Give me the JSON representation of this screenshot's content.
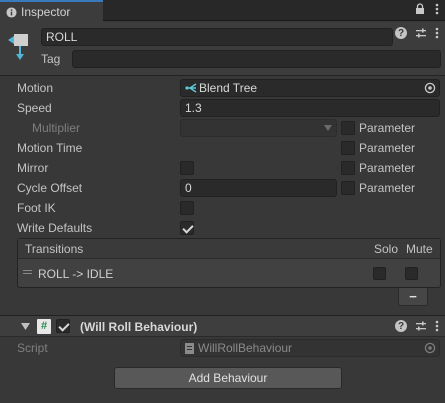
{
  "window": {
    "tab_label": "Inspector"
  },
  "state": {
    "name": "ROLL",
    "tag_label": "Tag",
    "tag_value": ""
  },
  "properties": {
    "motion_label": "Motion",
    "motion_value": "Blend Tree",
    "speed_label": "Speed",
    "speed_value": "1.3",
    "multiplier_label": "Multiplier",
    "motion_time_label": "Motion Time",
    "mirror_label": "Mirror",
    "cycle_offset_label": "Cycle Offset",
    "cycle_offset_value": "0",
    "foot_ik_label": "Foot IK",
    "write_defaults_label": "Write Defaults",
    "parameter_label": "Parameter"
  },
  "checks": {
    "multiplier_param": false,
    "motion_time_param": false,
    "mirror": false,
    "mirror_param": false,
    "cycle_offset_param": false,
    "foot_ik": false,
    "write_defaults": true
  },
  "transitions": {
    "header": "Transitions",
    "solo_label": "Solo",
    "mute_label": "Mute",
    "items": [
      {
        "label": "ROLL -> IDLE",
        "solo": false,
        "mute": false
      }
    ],
    "remove_label": "−"
  },
  "behaviour": {
    "title": "(Will Roll Behaviour)",
    "enabled": true,
    "script_label": "Script",
    "script_value": "WillRollBehaviour",
    "add_label": "Add Behaviour"
  },
  "colors": {
    "accent": "#3a79bb",
    "background": "#383838",
    "field": "#2a2a2a",
    "blend_tree_icon": "#5fc8d8"
  },
  "icons": {
    "inspector_tab": "info-icon",
    "lock": "lock-icon",
    "menu": "kebab-menu-icon",
    "help": "help-icon",
    "presets": "sliders-icon",
    "state": "animator-state-icon",
    "blend_tree": "blend-tree-icon",
    "object_picker": "target-icon",
    "script": "script-icon",
    "drag_handle": "drag-handle-icon",
    "foldout": "triangle-down-icon"
  }
}
